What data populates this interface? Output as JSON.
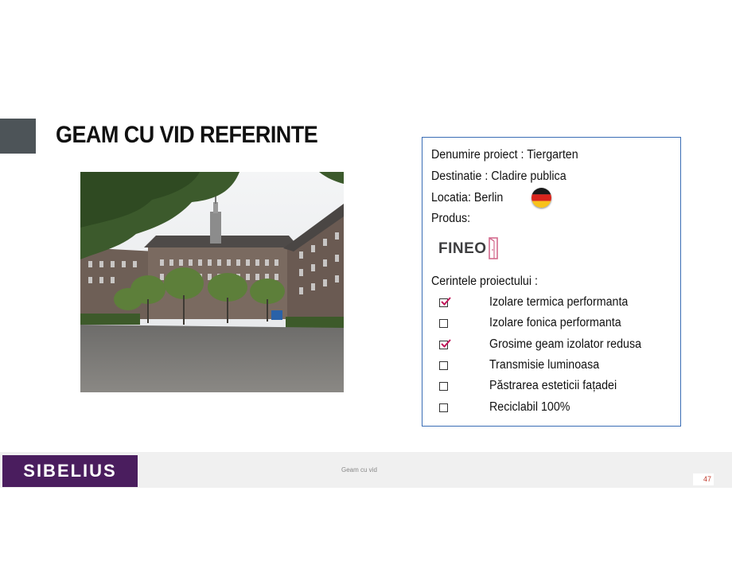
{
  "slide": {
    "title": "GEAM CU VID REFERINTE"
  },
  "project": {
    "name_line": "Denumire proiect : Tiergarten",
    "destination_line": "Destinatie : Cladire publica",
    "location_line": "Locatia: Berlin",
    "product_line": "Produs:",
    "flag_icon": "germany-flag-icon",
    "product_logo": "FINEO",
    "requirements_heading": "Cerintele proiectului :",
    "requirements": [
      {
        "label": "Izolare termica performanta",
        "checked": true
      },
      {
        "label": "Izolare fonica performanta",
        "checked": false
      },
      {
        "label": "Grosime geam izolator redusa",
        "checked": true
      },
      {
        "label": "Transmisie luminoasa",
        "checked": false
      },
      {
        "label": "Păstrarea esteticii fațadei",
        "checked": false
      },
      {
        "label": "Reciclabil 100%",
        "checked": false
      }
    ]
  },
  "footer": {
    "logo": "SIBELIUS",
    "text": "Geam cu vid",
    "page_number": "47"
  },
  "colors": {
    "accent_block": "#4d5458",
    "box_border": "#3a6db5",
    "logo_bg": "#4a1d5e",
    "check_mark": "#c2185b",
    "fineo_pink": "#d36b8e"
  }
}
